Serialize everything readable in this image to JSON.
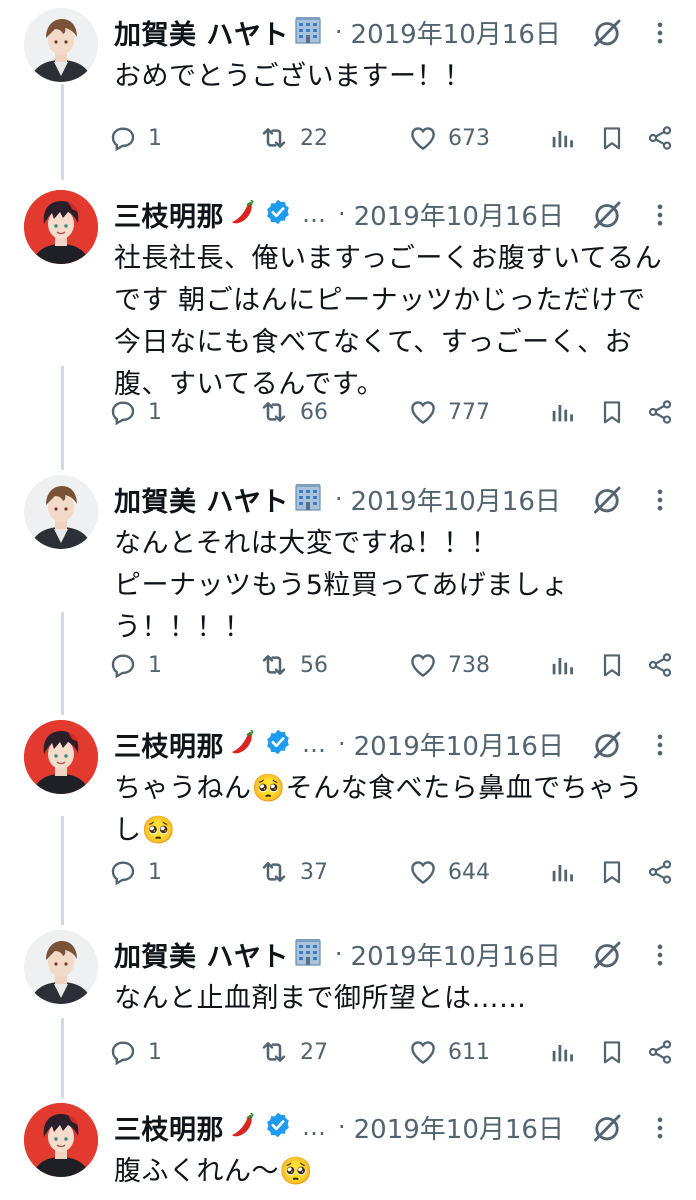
{
  "tweets": [
    {
      "author": "加賀美 ハヤト",
      "author_emoji": "office-building",
      "avatar": "kagami",
      "verified": false,
      "truncated": false,
      "date": "2019年10月16日",
      "lines": [
        "おめでとうございますー！！"
      ],
      "replies": "1",
      "retweets": "22",
      "likes": "673"
    },
    {
      "author": "三枝明那",
      "author_emoji": "hot-pepper",
      "avatar": "saegusa",
      "verified": true,
      "truncated": true,
      "date": "2019年10月16日",
      "lines": [
        "社長社長、俺いますっごーくお腹すいてるん",
        "です 朝ごはんにピーナッツかじっただけで",
        "今日なにも食べてなくて、すっごーく、お",
        "腹、すいてるんです。"
      ],
      "replies": "1",
      "retweets": "66",
      "likes": "777"
    },
    {
      "author": "加賀美 ハヤト",
      "author_emoji": "office-building",
      "avatar": "kagami",
      "verified": false,
      "truncated": false,
      "date": "2019年10月16日",
      "lines": [
        "なんとそれは大変ですね！！！",
        "ピーナッツもう5粒買ってあげましょ",
        "う！！！！"
      ],
      "replies": "1",
      "retweets": "56",
      "likes": "738"
    },
    {
      "author": "三枝明那",
      "author_emoji": "hot-pepper",
      "avatar": "saegusa",
      "verified": true,
      "truncated": true,
      "date": "2019年10月16日",
      "lines": [
        "ちゃうねん🥺そんな食べたら鼻血でちゃう",
        "し🥺"
      ],
      "replies": "1",
      "retweets": "37",
      "likes": "644"
    },
    {
      "author": "加賀美 ハヤト",
      "author_emoji": "office-building",
      "avatar": "kagami",
      "verified": false,
      "truncated": false,
      "date": "2019年10月16日",
      "lines": [
        "なんと止血剤まで御所望とは……"
      ],
      "replies": "1",
      "retweets": "27",
      "likes": "611"
    },
    {
      "author": "三枝明那",
      "author_emoji": "hot-pepper",
      "avatar": "saegusa",
      "verified": true,
      "truncated": true,
      "date": "2019年10月16日",
      "lines": [
        "腹ふくれん〜🥺"
      ]
    }
  ],
  "ui": {
    "ellipsis": "…",
    "separator": "·"
  },
  "colors": {
    "muted": "#536471",
    "verified": "#1d9bf0",
    "thread_line": "#cfd9de",
    "text": "#0f1419"
  }
}
